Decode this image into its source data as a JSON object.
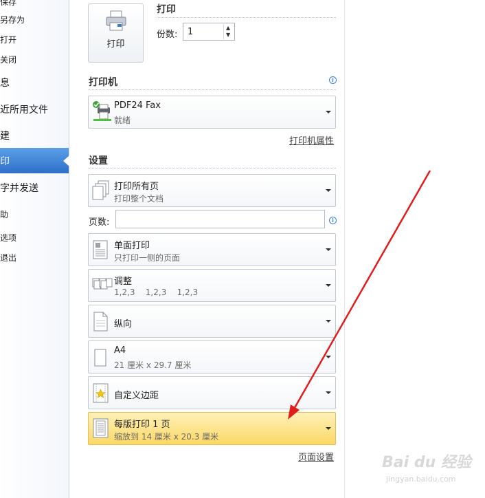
{
  "sidebar": {
    "items": [
      {
        "label": "保存"
      },
      {
        "label": "另存为"
      },
      {
        "label": "打开"
      },
      {
        "label": "关闭"
      },
      {
        "label": "息"
      },
      {
        "label": "近所用文件"
      },
      {
        "label": "建"
      },
      {
        "label": "印"
      },
      {
        "label": "字并发送"
      },
      {
        "label": "助"
      },
      {
        "label": "选项"
      },
      {
        "label": "退出"
      }
    ]
  },
  "print": {
    "button_label": "打印",
    "title": "打印",
    "copies_label": "份数:",
    "copies_value": "1"
  },
  "printer": {
    "heading": "打印机",
    "name": "PDF24 Fax",
    "status": "就绪",
    "properties_link": "打印机属性"
  },
  "settings": {
    "heading": "设置",
    "pages_label": "页数:",
    "pages_value": "",
    "options": [
      {
        "title": "打印所有页",
        "subtitle": "打印整个文档"
      },
      {
        "title": "单面打印",
        "subtitle": "只打印一侧的页面"
      },
      {
        "title": "调整",
        "subtitle": "1,2,3    1,2,3    1,2,3"
      },
      {
        "title": "纵向",
        "subtitle": ""
      },
      {
        "title": "A4",
        "subtitle": "21 厘米 x 29.7 厘米"
      },
      {
        "title": "自定义边距",
        "subtitle": ""
      },
      {
        "title": "每版打印 1 页",
        "subtitle": "缩放到 14 厘米 x 20.3 厘米"
      }
    ],
    "page_setup_link": "页面设置"
  },
  "watermark": {
    "logo": "Bai du 经验",
    "url": "jingyan.baidu.com"
  },
  "colors": {
    "accent": "#2f6fc9",
    "highlight": "#fbd865",
    "annotation_arrow": "#e21b1b"
  }
}
